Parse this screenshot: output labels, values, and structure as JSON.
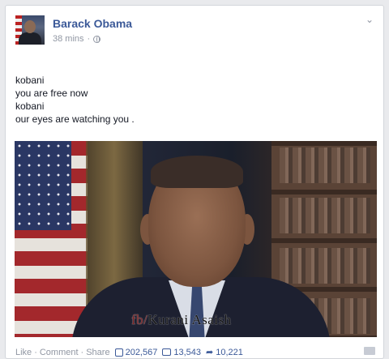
{
  "post": {
    "author": "Barack Obama",
    "time": "38 mins",
    "privacy_icon": "globe-icon",
    "lines": [
      "kobani",
      "you are free now",
      "kobani",
      "our eyes are watching you ."
    ],
    "photo_watermark_prefix": "fb/",
    "photo_watermark_name": "Kurani Asaish"
  },
  "actions": {
    "like": "Like",
    "comment": "Comment",
    "share": "Share",
    "separator": "·",
    "likes_count": "202,567",
    "comments_count": "13,543",
    "shares_count": "10,221"
  },
  "colors": {
    "link": "#3b5998",
    "meta": "#9197a3",
    "background": "#e9eaed"
  }
}
